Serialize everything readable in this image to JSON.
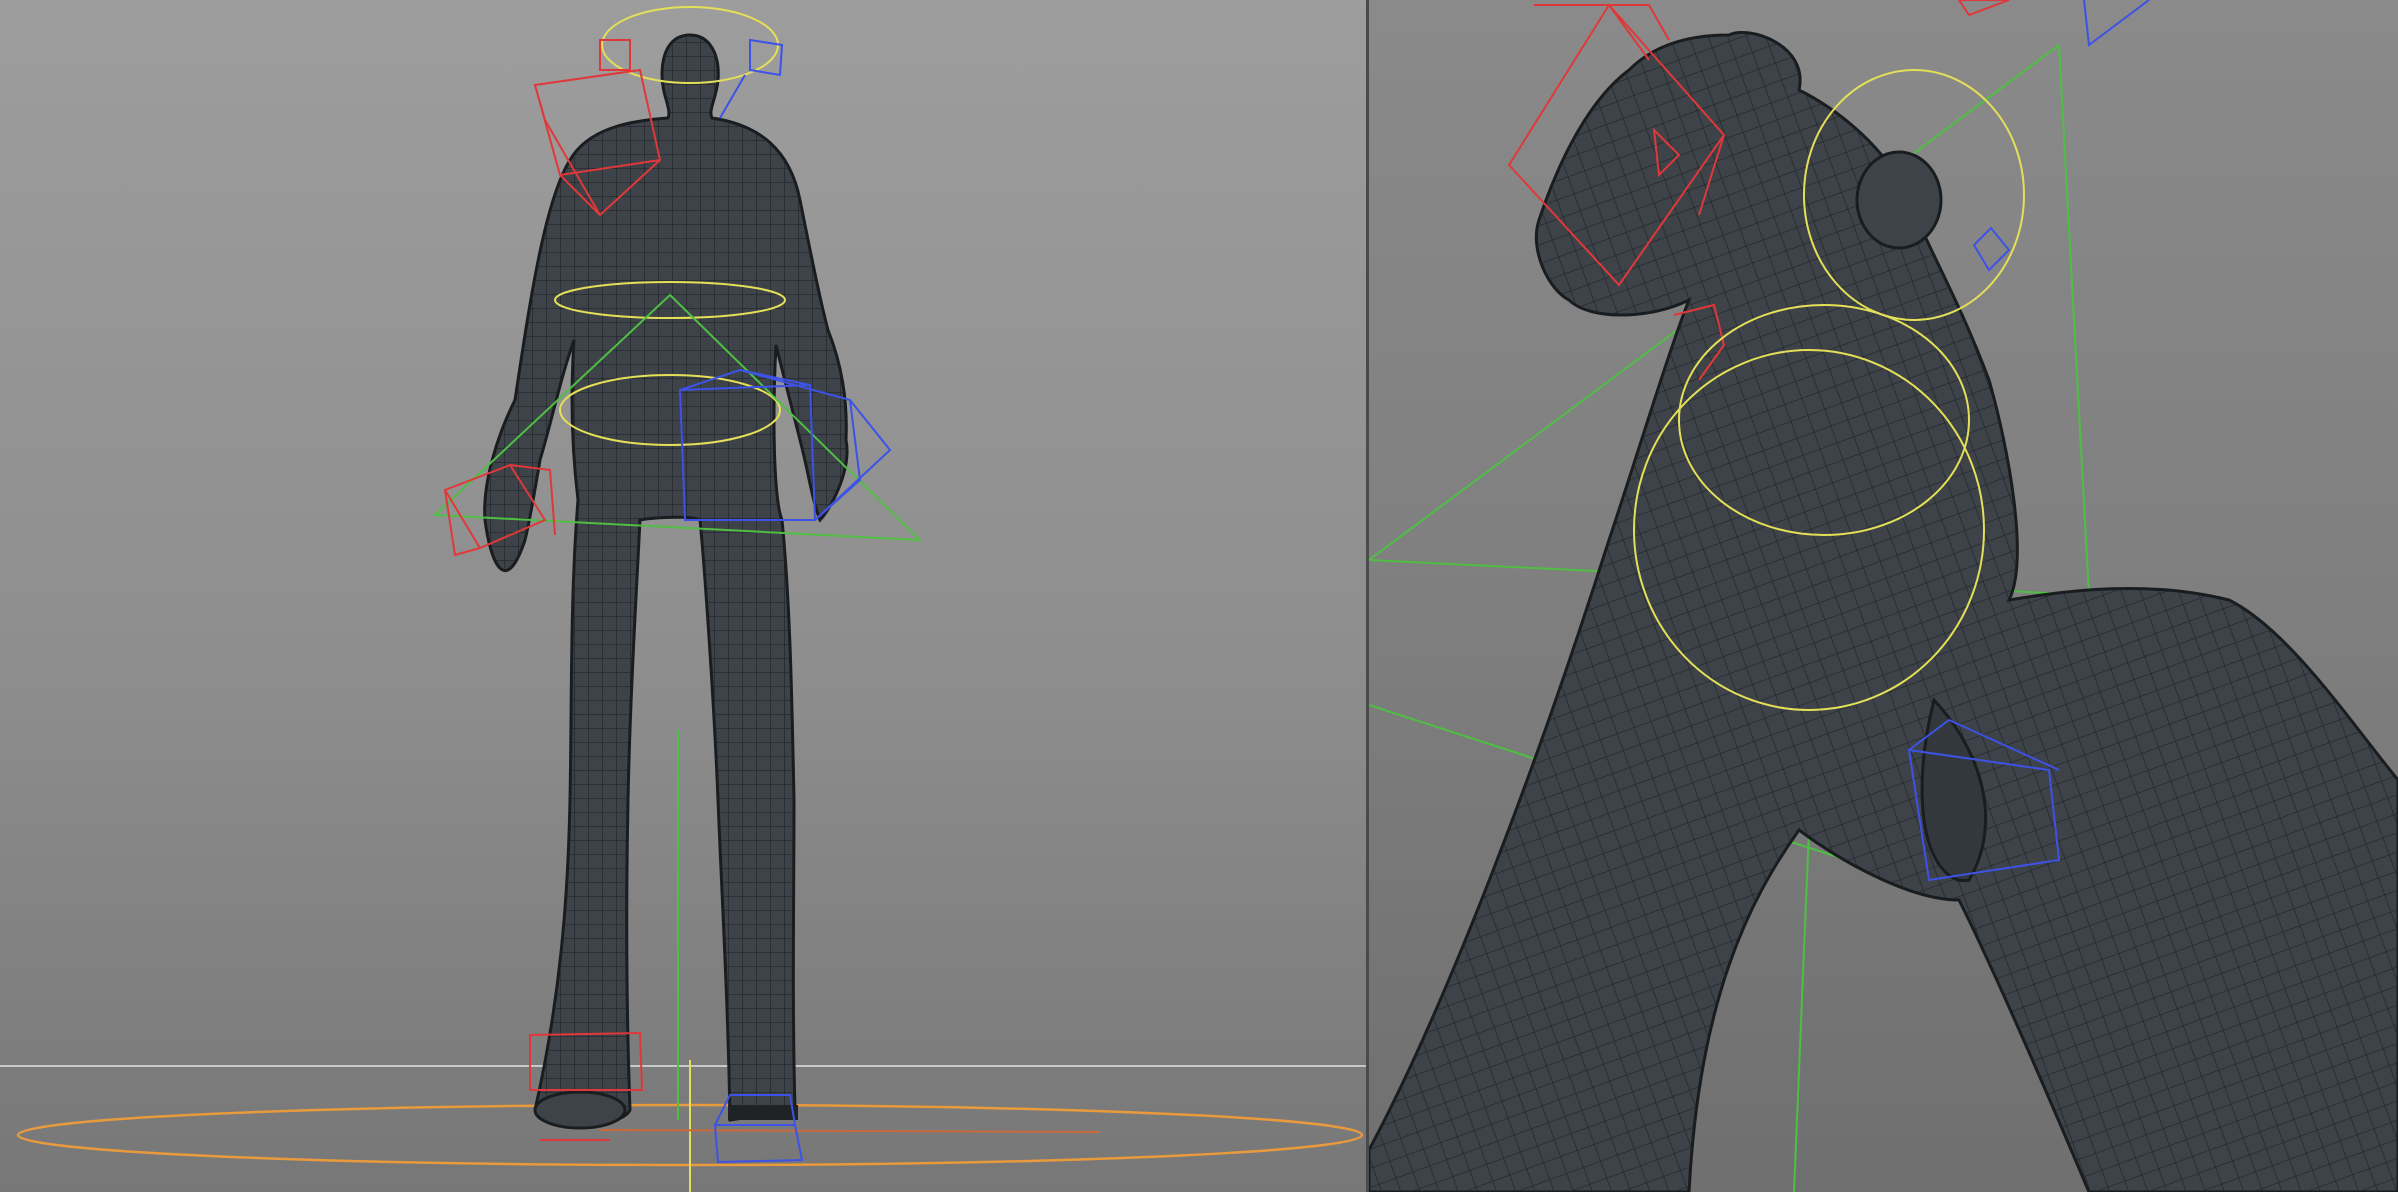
{
  "viewports": [
    {
      "name": "front",
      "description_label": ""
    },
    {
      "name": "low-angle",
      "description_label": ""
    }
  ],
  "colors": {
    "mesh": "#3d4348",
    "control_left": "#e0383a",
    "control_right": "#3d52e6",
    "control_center": "#e4df58",
    "ik_plane": "#4fbf43",
    "root_control": "#e99a3c"
  },
  "icons": [
    "character-mesh",
    "rig-control"
  ]
}
